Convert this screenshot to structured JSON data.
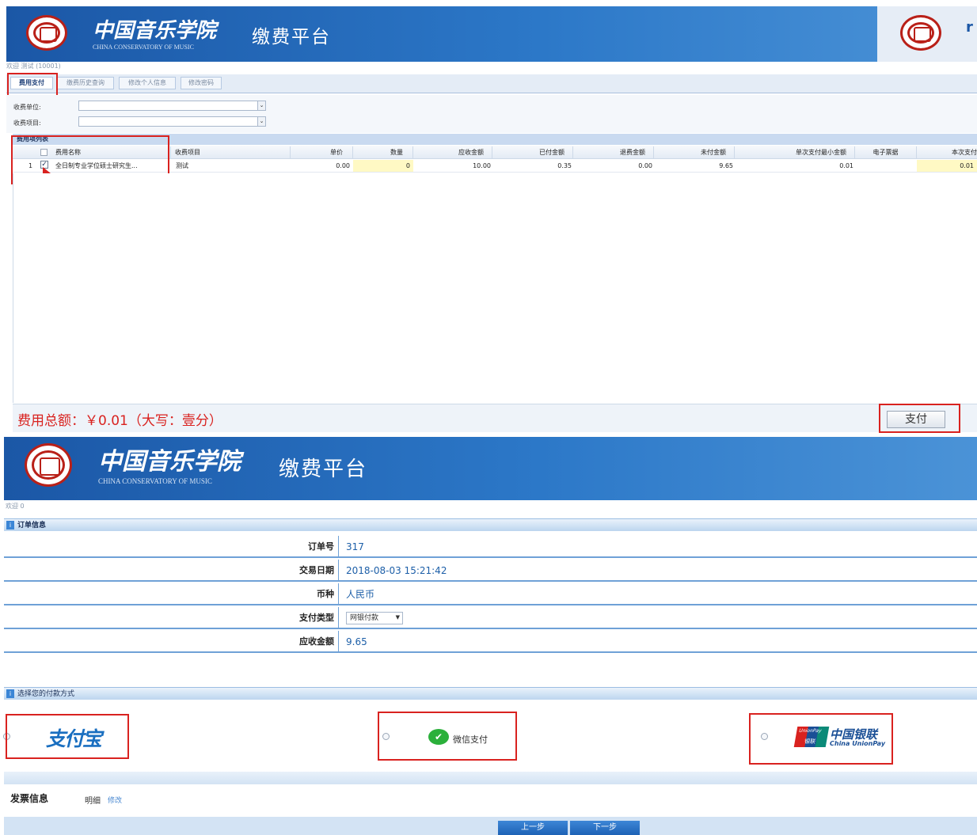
{
  "screen1": {
    "brand_cn": "中国音乐学院",
    "brand_en": "CHINA CONSERVATORY OF MUSIC",
    "platform": "缴费平台",
    "welcome": "欢迎 测试 (10001)",
    "tabs": [
      {
        "label": "费用支付"
      },
      {
        "label": "缴费历史查询"
      },
      {
        "label": "修改个人信息"
      },
      {
        "label": "修改密码"
      }
    ],
    "filters": {
      "unit_label": "收费单位:",
      "item_label": "收费项目:"
    },
    "list_title": "费用项列表",
    "headers": [
      "费用名称",
      "收费项目",
      "单价",
      "数量",
      "应收金额",
      "已付金额",
      "退费金额",
      "未付金额",
      "单次支付最小金额",
      "电子票据",
      "本次支付"
    ],
    "row": {
      "index": "1",
      "name": "全日制专业学位硕士研究生...",
      "item": "测试",
      "unit_price": "0.00",
      "quantity": "0",
      "receivable": "10.00",
      "paid": "0.35",
      "refund": "0.00",
      "unpaid": "9.65",
      "min_pay": "0.01",
      "e_invoice": "",
      "this_pay": "0.01"
    },
    "total_text": "费用总额：￥0.01（大写：壹分）",
    "pay_button": "支付"
  },
  "screen2": {
    "brand_cn": "中国音乐学院",
    "brand_en": "CHINA CONSERVATORY OF MUSIC",
    "platform": "缴费平台",
    "welcome": "欢迎 0",
    "order_section": "订单信息",
    "fields": [
      {
        "label": "订单号",
        "value": "317"
      },
      {
        "label": "交易日期",
        "value": "2018-08-03 15:21:42"
      },
      {
        "label": "币种",
        "value": "人民币"
      },
      {
        "label": "支付类型",
        "value": "网银付款"
      },
      {
        "label": "应收金额",
        "value": "9.65"
      }
    ],
    "method_section": "选择您的付款方式",
    "methods": {
      "alipay": "支付宝",
      "wechat": "微信支付",
      "unionpay_cn": "中国银联",
      "unionpay_en": "China UnionPay",
      "unionpay_badge_top": "UnionPay",
      "unionpay_badge_bottom": "银联"
    },
    "invoice_label": "发票信息",
    "invoice_value": "明细",
    "invoice_edit": "修改",
    "prev_button": "上一步",
    "next_button": "下一步"
  },
  "colors": {
    "banner": "#1b57a6",
    "accent_red": "#d9221f",
    "link_blue": "#1d5fa8"
  }
}
